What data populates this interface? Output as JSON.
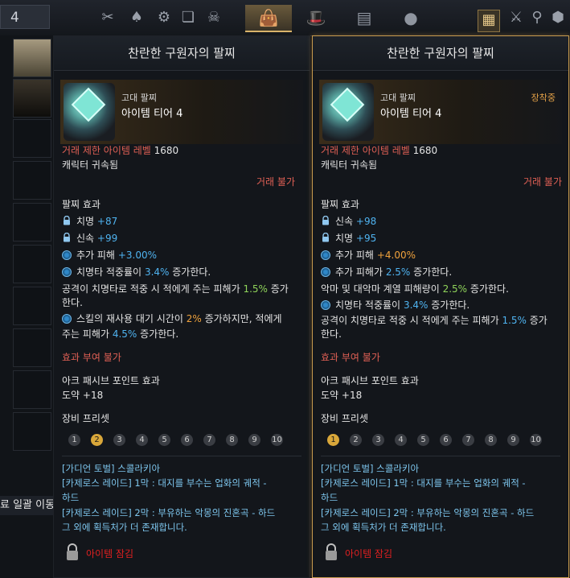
{
  "topbar": {
    "counter": "4",
    "colors": {
      "accent": "#d9b36a",
      "left_panel_border": "#1e2228",
      "right_panel_border": "#c79a4e"
    }
  },
  "inventory": {
    "bottom_text": "료 일괄 이동"
  },
  "left": {
    "title": "찬란한 구원자의 팔찌",
    "grade": "고대 팔찌",
    "tier": "아이템 티어 4",
    "req_label": "거래 제한 아이템 레벨",
    "req_value": "1680",
    "bound": "캐릭터 귀속됨",
    "trade": "거래 불가",
    "effects_heading": "팔찌 효과",
    "stat1_name": "치명",
    "stat1_val": "+87",
    "stat2_name": "신속",
    "stat2_val": "+99",
    "eff1_name": "추가 피해",
    "eff1_val": "+3.00%",
    "eff2_a": "치명타 적중률이",
    "eff2_val": "3.4%",
    "eff2_b": "증가한다.",
    "eff3_a": "공격이 치명타로 적중 시 적에게 주는 피해가",
    "eff3_val": "1.5%",
    "eff3_b": "증가",
    "eff3_c": "한다.",
    "eff4_a": "스킬의 재사용 대기 시간이",
    "eff4_val": "2%",
    "eff4_b": "증가하지만, 적에게",
    "eff4_c": "주는 피해가",
    "eff4_val2": "4.5%",
    "eff4_d": "증가한다.",
    "no_effect": "효과 부여 불가",
    "ark_heading": "아크 패시브 포인트 효과",
    "ark_value": "도약 +18",
    "preset_heading": "장비 프리셋",
    "presets": [
      "1",
      "2",
      "3",
      "4",
      "5",
      "6",
      "7",
      "8",
      "9",
      "10"
    ],
    "preset_selected": 2,
    "src1": "[가디언 토벌] 스콜라키아",
    "src2a": "[카제로스 레이드] 1막 : 대지를 부수는 업화의 궤적 -",
    "src2b": "하드",
    "src3": "[카제로스 레이드] 2막 : 부유하는 악몽의 진혼곡 - 하드",
    "src4": "그 외에 획득처가 더 존재합니다.",
    "locked": "아이템 잠김"
  },
  "right": {
    "title": "찬란한 구원자의 팔찌",
    "grade": "고대 팔찌",
    "tier": "아이템 티어 4",
    "equipped": "장착중",
    "req_label": "거래 제한 아이템 레벨",
    "req_value": "1680",
    "bound": "캐릭터 귀속됨",
    "trade": "거래 불가",
    "effects_heading": "팔찌 효과",
    "stat1_name": "신속",
    "stat1_val": "+98",
    "stat2_name": "치명",
    "stat2_val": "+95",
    "eff1_name": "추가 피해",
    "eff1_val": "+4.00%",
    "eff2_a": "추가 피해가",
    "eff2_val": "2.5%",
    "eff2_b": "증가한다.",
    "eff3_a": "악마 및 대악마 계열 피해량이",
    "eff3_val": "2.5%",
    "eff3_b": "증가한다.",
    "eff4_a": "치명타 적중률이",
    "eff4_val": "3.4%",
    "eff4_b": "증가한다.",
    "eff5_a": "공격이 치명타로 적중 시 적에게 주는 피해가",
    "eff5_val": "1.5%",
    "eff5_b": "증가",
    "eff5_c": "한다.",
    "no_effect": "효과 부여 불가",
    "ark_heading": "아크 패시브 포인트 효과",
    "ark_value": "도약 +18",
    "preset_heading": "장비 프리셋",
    "presets": [
      "1",
      "2",
      "3",
      "4",
      "5",
      "6",
      "7",
      "8",
      "9",
      "10"
    ],
    "preset_selected": 1,
    "src1": "[가디언 토벌] 스콜라키아",
    "src2a": "[카제로스 레이드] 1막 : 대지를 부수는 업화의 궤적 -",
    "src2b": "하드",
    "src3": "[카제로스 레이드] 2막 : 부유하는 악몽의 진혼곡 - 하드",
    "src4": "그 외에 획득처가 더 존재합니다.",
    "locked": "아이템 잠김"
  }
}
